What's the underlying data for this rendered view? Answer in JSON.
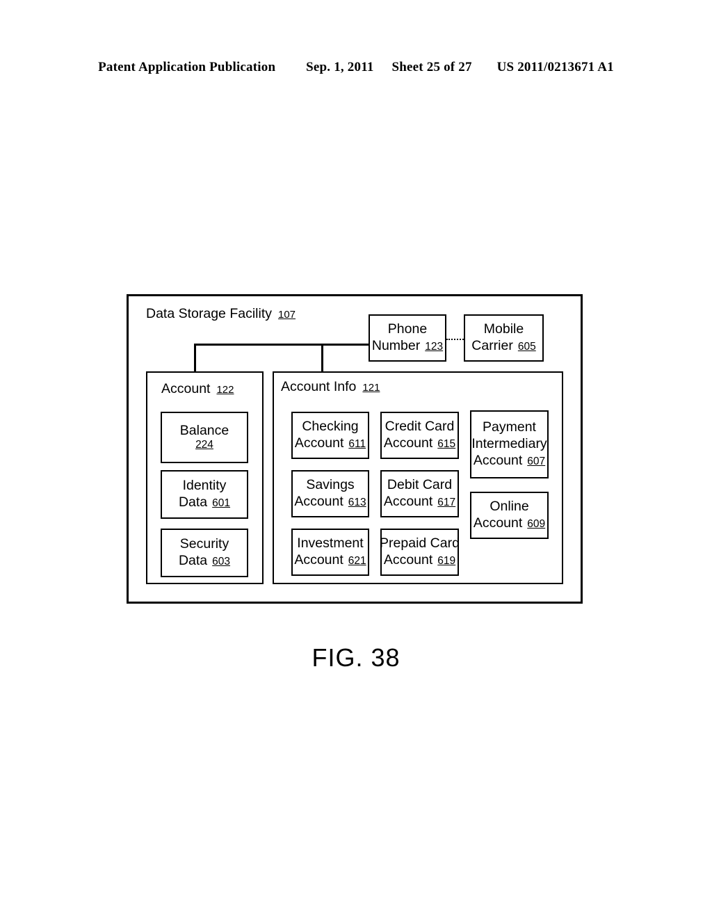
{
  "header": {
    "publication": "Patent Application Publication",
    "date": "Sep. 1, 2011",
    "sheet": "Sheet 25 of 27",
    "patent_number": "US 2011/0213671 A1"
  },
  "figure": {
    "caption": "FIG. 38",
    "outer": {
      "label": "Data Storage Facility",
      "ref": "107"
    },
    "phone_number": {
      "line1": "Phone",
      "line2": "Number",
      "ref": "123"
    },
    "mobile_carrier": {
      "line1": "Mobile",
      "line2": "Carrier",
      "ref": "605"
    },
    "account_group": {
      "label": "Account",
      "ref": "122",
      "items": [
        {
          "line1": "Balance",
          "line2": "",
          "ref": "224",
          "ref_on_own_line": true
        },
        {
          "line1": "Identity",
          "line2": "Data",
          "ref": "601",
          "ref_on_own_line": false
        },
        {
          "line1": "Security",
          "line2": "Data",
          "ref": "603",
          "ref_on_own_line": false
        }
      ]
    },
    "account_info_group": {
      "label": "Account Info",
      "ref": "121",
      "column1": [
        {
          "line1": "Checking",
          "line2": "Account",
          "ref": "611"
        },
        {
          "line1": "Savings",
          "line2": "Account",
          "ref": "613"
        },
        {
          "line1": "Investment",
          "line2": "Account",
          "ref": "621"
        }
      ],
      "column2": [
        {
          "line1": "Credit Card",
          "line2": "Account",
          "ref": "615"
        },
        {
          "line1": "Debit Card",
          "line2": "Account",
          "ref": "617"
        },
        {
          "line1": "Prepaid Card",
          "line2": "Account",
          "ref": "619"
        }
      ],
      "column3": [
        {
          "line1": "Payment",
          "line2": "Intermediary",
          "line3": "Account",
          "ref": "607"
        },
        {
          "line1": "Online",
          "line2": "Account",
          "ref": "609"
        }
      ]
    }
  },
  "colors": {
    "ink": "#000000",
    "paper": "#ffffff"
  }
}
